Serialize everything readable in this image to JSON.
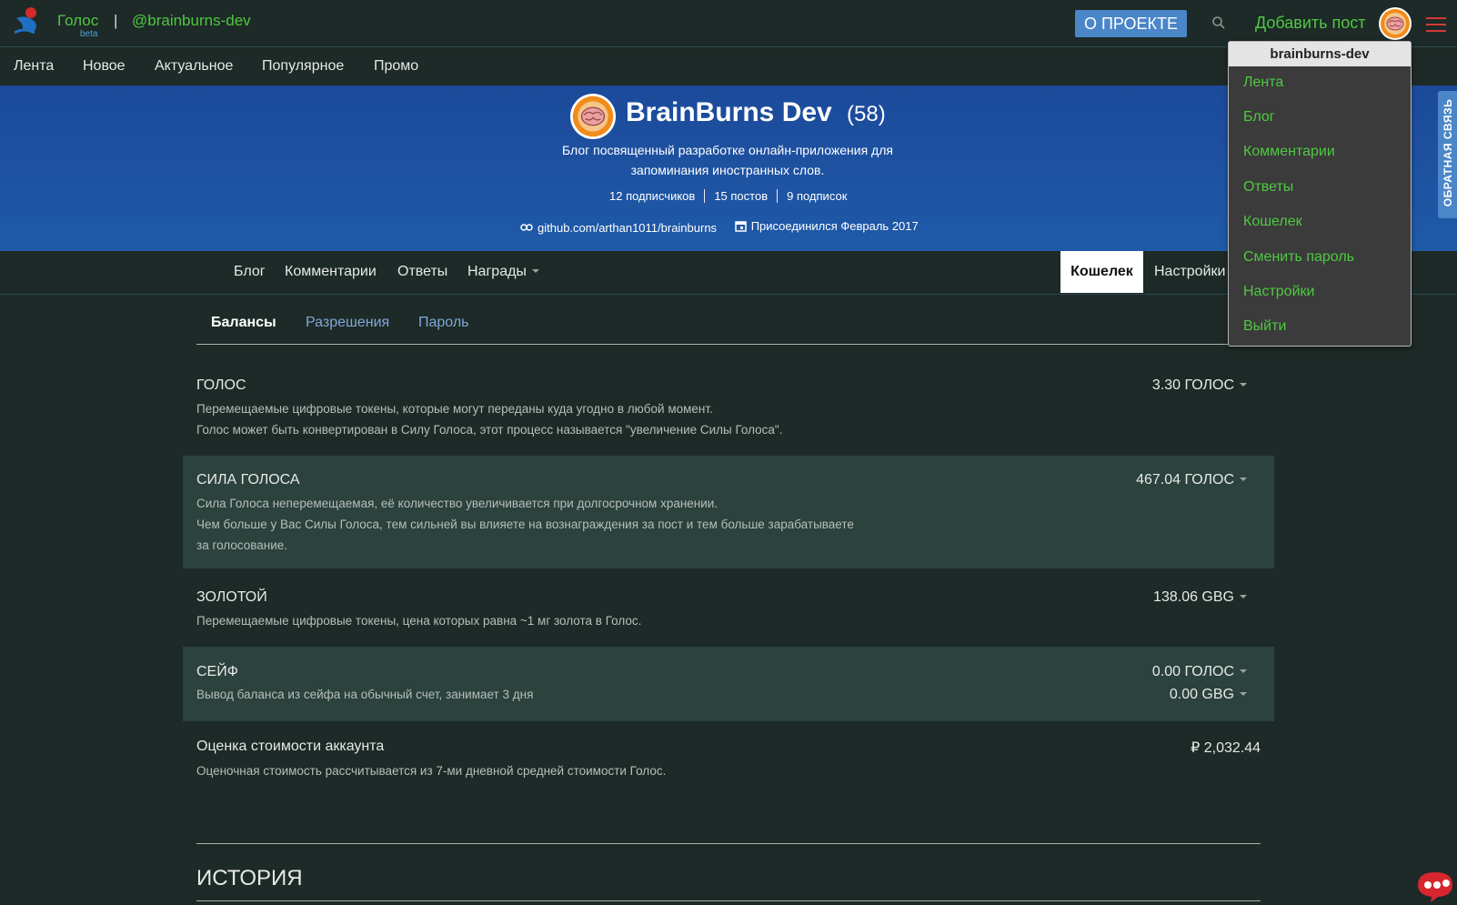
{
  "header": {
    "brand": "Голос",
    "brand_beta": "beta",
    "separator": "|",
    "username": "@brainburns-dev",
    "about_button": "О ПРОЕКТЕ",
    "add_post": "Добавить пост",
    "icons": [
      "golos-logo-icon",
      "search-icon",
      "avatar",
      "hamburger-menu-icon"
    ]
  },
  "secondary_nav": [
    "Лента",
    "Новое",
    "Актуальное",
    "Популярное",
    "Промо"
  ],
  "banner": {
    "name": "BrainBurns Dev",
    "reputation": "(58)",
    "about_line1": "Блог посвященный разработке онлайн-приложения для",
    "about_line2": "запоминания иностранных слов.",
    "followers": "12 подписчиков",
    "posts": "15 постов",
    "following": "9 подписок",
    "website": "github.com/arthan1011/brainburns",
    "joined": "Присоединился Февраль 2017"
  },
  "profile_tabs": {
    "blog": "Блог",
    "comments": "Комментарии",
    "replies": "Ответы",
    "rewards": "Награды",
    "wallet": "Кошелек",
    "settings": "Настройки"
  },
  "wallet_tabs": {
    "balances": "Балансы",
    "permissions": "Разрешения",
    "password": "Пароль"
  },
  "balances": [
    {
      "title": "ГОЛОС",
      "desc1": "Перемещаемые цифровые токены, которые могут переданы куда угодно в любой момент.",
      "desc2": "Голос может быть конвертирован в Силу Голоса, этот процесс называется \"увеличение Силы Голоса\".",
      "value": "3.30 ГОЛОС"
    },
    {
      "title": "СИЛА ГОЛОСА",
      "desc1": "Сила Голоса неперемещаемая, её количество увеличивается при долгосрочном хранении.",
      "desc2": "Чем больше у Вас Силы Голоса, тем сильней вы влияете на вознаграждения за пост и тем больше зарабатываете",
      "desc3": "за голосование.",
      "value": "467.04 ГОЛОС"
    },
    {
      "title": "ЗОЛОТОЙ",
      "desc1": "Перемещаемые цифровые токены, цена которых равна ~1 мг золота в Голос.",
      "value": "138.06 GBG"
    },
    {
      "title": "СЕЙФ",
      "desc1": "Вывод баланса из сейфа на обычный счет, занимает 3 дня",
      "value": "0.00 ГОЛОС",
      "value2": "0.00 GBG"
    },
    {
      "title": "Оценка стоимости аккаунта",
      "desc1": "Оценочная стоимость рассчитывается из 7-ми дневной средней стоимости Голос.",
      "value": "₽ 2,032.44"
    }
  ],
  "history_title": "ИСТОРИЯ",
  "user_menu": {
    "header": "brainburns-dev",
    "items": [
      "Лента",
      "Блог",
      "Комментарии",
      "Ответы",
      "Кошелек",
      "Сменить пароль",
      "Настройки",
      "Выйти"
    ]
  },
  "feedback_tab": "ОБРАТНАЯ СВЯЗЬ",
  "colors": {
    "background": "#1d2a27",
    "accent_green": "#4fc842",
    "accent_blue": "#4a86c8",
    "banner_blue": "#1f5aa8",
    "shaded_row": "#2b423d"
  }
}
